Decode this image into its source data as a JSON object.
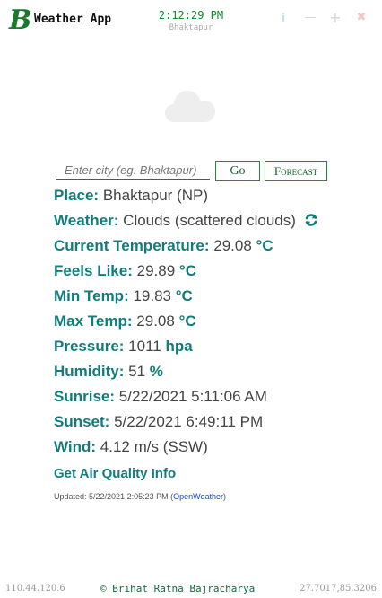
{
  "titlebar": {
    "logo_letter": "B",
    "app_title": "Weather App",
    "clock_time": "2:12:29 PM",
    "clock_city": "Bhaktapur",
    "info_symbol": "i",
    "minimize_symbol": "—",
    "maximize_symbol": "+",
    "close_symbol": "✖"
  },
  "weather_icon": "cloud-icon",
  "search": {
    "placeholder": "Enter city (eg. Bhaktapur)",
    "value": "",
    "go_label": "Go",
    "forecast_label": "Forecast"
  },
  "info": {
    "place": {
      "label": "Place:",
      "value": "Bhaktapur (NP)"
    },
    "weather": {
      "label": "Weather:",
      "value": "Clouds (scattered clouds)"
    },
    "current_temp": {
      "label": "Current Temperature:",
      "value": "29.08",
      "unit": "°C"
    },
    "feels_like": {
      "label": "Feels Like:",
      "value": "29.89",
      "unit": "°C"
    },
    "min_temp": {
      "label": "Min Temp:",
      "value": "19.83",
      "unit": "°C"
    },
    "max_temp": {
      "label": "Max Temp:",
      "value": "29.08",
      "unit": "°C"
    },
    "pressure": {
      "label": "Pressure:",
      "value": "1011",
      "unit": "hpa"
    },
    "humidity": {
      "label": "Humidity:",
      "value": "51",
      "unit": "%"
    },
    "sunrise": {
      "label": "Sunrise:",
      "value": "5/22/2021 5:11:06 AM"
    },
    "sunset": {
      "label": "Sunset:",
      "value": "5/22/2021 6:49:11 PM"
    },
    "wind": {
      "label": "Wind:",
      "value": "4.12 m/s (SSW)"
    },
    "air_quality_link": "Get Air Quality Info"
  },
  "updated": {
    "prefix": "Updated: 5/22/2021 2:05:23 PM (",
    "source": "OpenWeather",
    "suffix": ")"
  },
  "footer": {
    "ip": "110.44.120.6",
    "credit": "© Brihat Ratna Bajracharya",
    "coords": "27.7017,85.3206"
  },
  "colors": {
    "accent_teal": "#117c7c",
    "brand_green": "#1d8a3c",
    "clock_green": "#0b8a2c"
  }
}
